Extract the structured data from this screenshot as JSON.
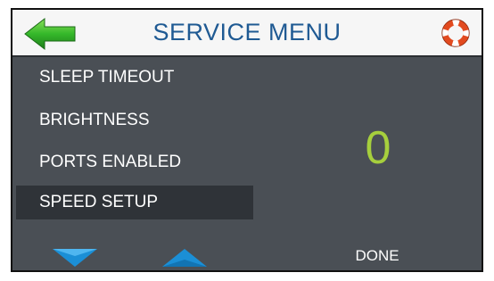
{
  "header": {
    "title": "SERVICE MENU",
    "back_icon": "back-arrow-icon",
    "help_icon": "lifebuoy-icon"
  },
  "menu": {
    "items": [
      {
        "label": "SLEEP TIMEOUT",
        "selected": false
      },
      {
        "label": "BRIGHTNESS",
        "selected": false
      },
      {
        "label": "PORTS ENABLED",
        "selected": false
      },
      {
        "label": "SPEED SETUP",
        "selected": true
      }
    ]
  },
  "value_display": "0",
  "footer": {
    "down_icon": "down-arrow-icon",
    "up_icon": "up-arrow-icon",
    "done_label": "DONE"
  },
  "colors": {
    "background": "#4a4f55",
    "header_bg": "#f6f6f6",
    "title": "#1f5a93",
    "value": "#a6cf3d",
    "arrow": "#1b8fd6",
    "selected_row": "#2f3338"
  }
}
